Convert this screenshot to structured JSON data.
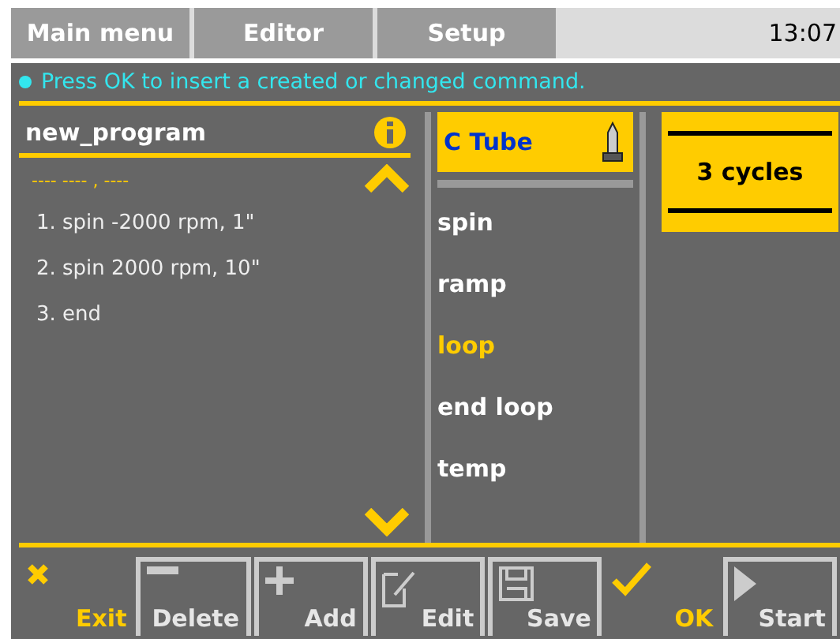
{
  "tabs": [
    {
      "label": "Main menu"
    },
    {
      "label": "Editor"
    },
    {
      "label": "Setup"
    }
  ],
  "time": "13:07",
  "message": "Press OK to insert a created or changed command.",
  "program": {
    "name": "new_program",
    "placeholder_line": "---- ---- , ----",
    "steps": [
      "1. spin -2000 rpm, 1\"",
      "2. spin 2000 rpm, 10\"",
      "3. end"
    ]
  },
  "rotor": {
    "label": "C Tube"
  },
  "commands": [
    {
      "label": "spin",
      "selected": false
    },
    {
      "label": "ramp",
      "selected": false
    },
    {
      "label": "loop",
      "selected": true
    },
    {
      "label": "end loop",
      "selected": false
    },
    {
      "label": "temp",
      "selected": false
    }
  ],
  "value": {
    "label": "3 cycles"
  },
  "buttons": [
    {
      "label": "Exit",
      "kind": "accent"
    },
    {
      "label": "Delete",
      "kind": "framed"
    },
    {
      "label": "Add",
      "kind": "framed"
    },
    {
      "label": "Edit",
      "kind": "framed"
    },
    {
      "label": "Save",
      "kind": "framed"
    },
    {
      "label": "OK",
      "kind": "accent"
    },
    {
      "label": "Start",
      "kind": "framed"
    }
  ]
}
